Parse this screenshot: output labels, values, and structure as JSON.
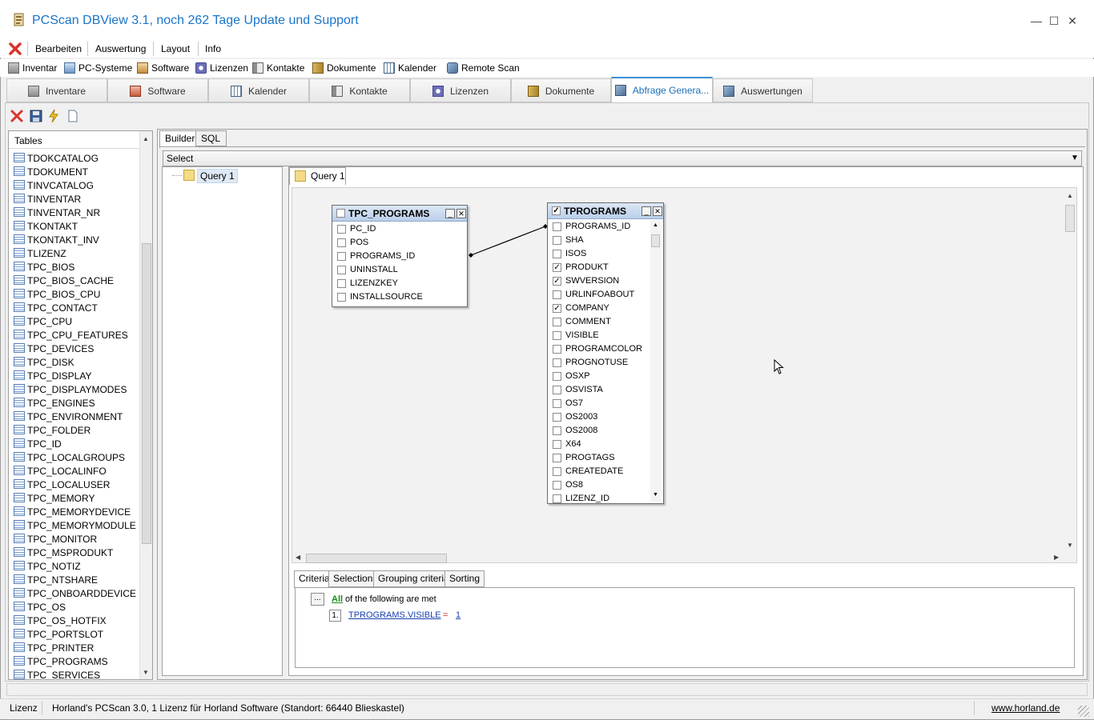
{
  "window": {
    "title": "PCScan DBView 3.1, noch 262 Tage Update und Support",
    "minimize_glyph": "—",
    "maximize_glyph": "☐",
    "close_glyph": "✕"
  },
  "menu": {
    "items": [
      "Bearbeiten",
      "Auswertung",
      "Layout",
      "Info"
    ]
  },
  "nav": {
    "items": [
      {
        "label": "Inventar",
        "icon": "inventory-icon"
      },
      {
        "label": "PC-Systeme",
        "icon": "pc-systems-icon"
      },
      {
        "label": "Software",
        "icon": "software-icon"
      },
      {
        "label": "Lizenzen",
        "icon": "license-icon"
      },
      {
        "label": "Kontakte",
        "icon": "contacts-icon"
      },
      {
        "label": "Dokumente",
        "icon": "documents-icon"
      },
      {
        "label": "Kalender",
        "icon": "calendar-icon"
      },
      {
        "label": "Remote Scan",
        "icon": "remote-scan-icon"
      }
    ]
  },
  "tabs": [
    {
      "label": "Inventare"
    },
    {
      "label": "Software"
    },
    {
      "label": "Kalender"
    },
    {
      "label": "Kontakte"
    },
    {
      "label": "Lizenzen"
    },
    {
      "label": "Dokumente"
    },
    {
      "label": "Abfrage Genera..."
    },
    {
      "label": "Auswertungen"
    }
  ],
  "active_tab": "Abfrage Genera...",
  "tables_panel": {
    "header": "Tables",
    "items": [
      "TDOKCATALOG",
      "TDOKUMENT",
      "TINVCATALOG",
      "TINVENTAR",
      "TINVENTAR_NR",
      "TKONTAKT",
      "TKONTAKT_INV",
      "TLIZENZ",
      "TPC_BIOS",
      "TPC_BIOS_CACHE",
      "TPC_BIOS_CPU",
      "TPC_CONTACT",
      "TPC_CPU",
      "TPC_CPU_FEATURES",
      "TPC_DEVICES",
      "TPC_DISK",
      "TPC_DISPLAY",
      "TPC_DISPLAYMODES",
      "TPC_ENGINES",
      "TPC_ENVIRONMENT",
      "TPC_FOLDER",
      "TPC_ID",
      "TPC_LOCALGROUPS",
      "TPC_LOCALINFO",
      "TPC_LOCALUSER",
      "TPC_MEMORY",
      "TPC_MEMORYDEVICE",
      "TPC_MEMORYMODULE",
      "TPC_MONITOR",
      "TPC_MSPRODUKT",
      "TPC_NOTIZ",
      "TPC_NTSHARE",
      "TPC_ONBOARDDEVICE",
      "TPC_OS",
      "TPC_OS_HOTFIX",
      "TPC_PORTSLOT",
      "TPC_PRINTER",
      "TPC_PROGRAMS",
      "TPC_SERVICES"
    ]
  },
  "builder": {
    "tabs": [
      "Builder",
      "SQL"
    ],
    "select_value": "Select",
    "tree_item": "Query 1",
    "query_tab": "Query 1"
  },
  "table_tpc_programs": {
    "name": "TPC_PROGRAMS",
    "checked": false,
    "fields": [
      {
        "name": "PC_ID",
        "checked": false
      },
      {
        "name": "POS",
        "checked": false
      },
      {
        "name": "PROGRAMS_ID",
        "checked": false
      },
      {
        "name": "UNINSTALL",
        "checked": false
      },
      {
        "name": "LIZENZKEY",
        "checked": false
      },
      {
        "name": "INSTALLSOURCE",
        "checked": false
      }
    ]
  },
  "table_tprograms": {
    "name": "TPROGRAMS",
    "checked": true,
    "fields": [
      {
        "name": "PROGRAMS_ID",
        "checked": false
      },
      {
        "name": "SHA",
        "checked": false
      },
      {
        "name": "ISOS",
        "checked": false
      },
      {
        "name": "PRODUKT",
        "checked": true
      },
      {
        "name": "SWVERSION",
        "checked": true
      },
      {
        "name": "URLINFOABOUT",
        "checked": false
      },
      {
        "name": "COMPANY",
        "checked": true
      },
      {
        "name": "COMMENT",
        "checked": false
      },
      {
        "name": "VISIBLE",
        "checked": false
      },
      {
        "name": "PROGRAMCOLOR",
        "checked": false
      },
      {
        "name": "PROGNOTUSE",
        "checked": false
      },
      {
        "name": "OSXP",
        "checked": false
      },
      {
        "name": "OSVISTA",
        "checked": false
      },
      {
        "name": "OS7",
        "checked": false
      },
      {
        "name": "OS2003",
        "checked": false
      },
      {
        "name": "OS2008",
        "checked": false
      },
      {
        "name": "X64",
        "checked": false
      },
      {
        "name": "PROGTAGS",
        "checked": false
      },
      {
        "name": "CREATEDATE",
        "checked": false
      },
      {
        "name": "OS8",
        "checked": false
      },
      {
        "name": "LIZENZ_ID",
        "checked": false
      }
    ]
  },
  "bottom_tabs": [
    "Criteria",
    "Selection",
    "Grouping criteria",
    "Sorting"
  ],
  "criteria": {
    "button": "...",
    "all_word": "All",
    "text": "of the following are met",
    "row_index": "1.",
    "field": "TPROGRAMS.VISIBLE",
    "operator": "=",
    "value": "1"
  },
  "status": {
    "license_label": "Lizenz",
    "text": "Horland's PCScan 3.0, 1 Lizenz für Horland Software (Standort: 66440 Blieskastel)",
    "link": "www.horland.de"
  }
}
